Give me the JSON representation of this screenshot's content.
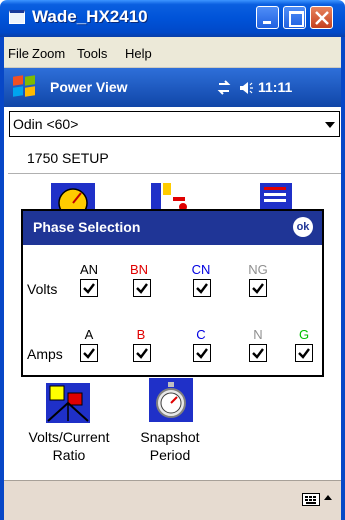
{
  "window": {
    "title": "Wade_HX2410"
  },
  "menu": [
    "File",
    "Zoom",
    "Tools",
    "Help"
  ],
  "pocket": {
    "title": "Power View",
    "time": "11:11"
  },
  "device_select": {
    "value": "Odin <60>"
  },
  "section": {
    "title": "1750 SETUP"
  },
  "tiles": {
    "volts_current_ratio": {
      "line1": "Volts/Current",
      "line2": "Ratio"
    },
    "snapshot_period": {
      "line1": "Snapshot",
      "line2": "Period"
    }
  },
  "dialog": {
    "title": "Phase Selection",
    "ok_label": "ok",
    "volts": {
      "label": "Volts",
      "columns": [
        {
          "label": "AN",
          "color": "#000000",
          "checked": true
        },
        {
          "label": "BN",
          "color": "#e00000",
          "checked": true
        },
        {
          "label": "CN",
          "color": "#0000e0",
          "checked": true
        },
        {
          "label": "NG",
          "color": "#909090",
          "checked": true
        }
      ]
    },
    "amps": {
      "label": "Amps",
      "columns": [
        {
          "label": "A",
          "color": "#000000",
          "checked": true
        },
        {
          "label": "B",
          "color": "#e00000",
          "checked": true
        },
        {
          "label": "C",
          "color": "#0000e0",
          "checked": true
        },
        {
          "label": "N",
          "color": "#909090",
          "checked": true
        },
        {
          "label": "G",
          "color": "#00c000",
          "checked": true
        }
      ]
    }
  }
}
